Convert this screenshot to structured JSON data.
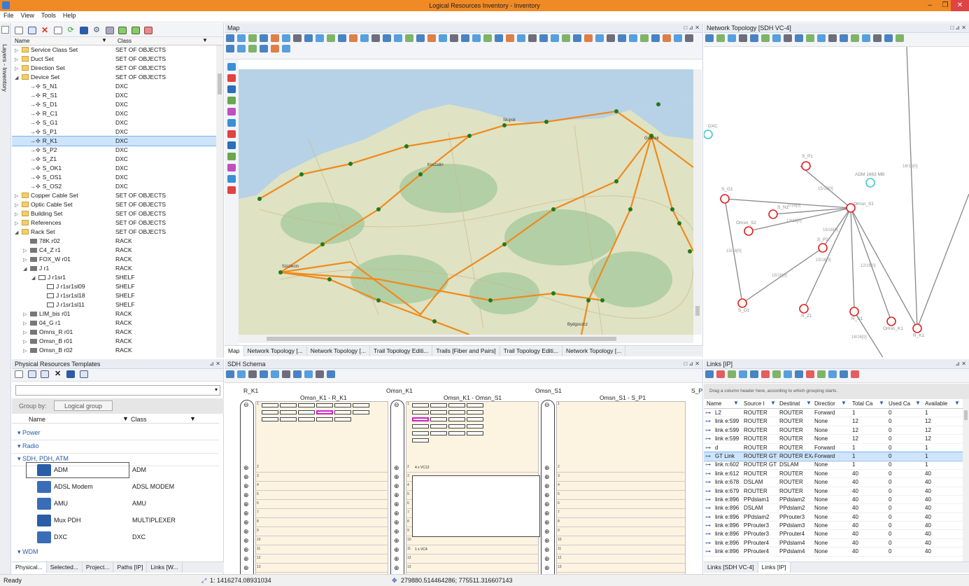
{
  "window": {
    "title": "Logical Resources Inventory - Inventory",
    "controls": [
      "–",
      "❐",
      "✕"
    ]
  },
  "menu": [
    "File",
    "View",
    "Tools",
    "Help"
  ],
  "left_side_tab": "Layers - Inventory",
  "tree": {
    "col_name": "Name",
    "col_class": "Class",
    "rows": [
      {
        "indent": 1,
        "exp": "▷",
        "icon": "folder",
        "name": "Service Class Set",
        "cls": "SET OF OBJECTS"
      },
      {
        "indent": 1,
        "exp": "▷",
        "icon": "folder",
        "name": "Duct Set",
        "cls": "SET OF OBJECTS"
      },
      {
        "indent": 1,
        "exp": "▷",
        "icon": "folder",
        "name": "Direction Set",
        "cls": "SET OF OBJECTS"
      },
      {
        "indent": 1,
        "exp": "◢",
        "icon": "folder",
        "name": "Device Set",
        "cls": "SET OF OBJECTS"
      },
      {
        "indent": 2,
        "exp": "",
        "icon": "dxc",
        "name": "S_N1",
        "cls": "DXC"
      },
      {
        "indent": 2,
        "exp": "",
        "icon": "dxc",
        "name": "R_S1",
        "cls": "DXC"
      },
      {
        "indent": 2,
        "exp": "",
        "icon": "dxc",
        "name": "S_D1",
        "cls": "DXC"
      },
      {
        "indent": 2,
        "exp": "",
        "icon": "dxc",
        "name": "R_C1",
        "cls": "DXC"
      },
      {
        "indent": 2,
        "exp": "",
        "icon": "dxc",
        "name": "S_G1",
        "cls": "DXC"
      },
      {
        "indent": 2,
        "exp": "",
        "icon": "dxc",
        "name": "S_P1",
        "cls": "DXC"
      },
      {
        "indent": 2,
        "exp": "",
        "icon": "dxc",
        "name": "R_K1",
        "cls": "DXC",
        "sel": true
      },
      {
        "indent": 2,
        "exp": "",
        "icon": "dxc",
        "name": "S_P2",
        "cls": "DXC"
      },
      {
        "indent": 2,
        "exp": "",
        "icon": "dxc",
        "name": "S_Z1",
        "cls": "DXC"
      },
      {
        "indent": 2,
        "exp": "",
        "icon": "dxc",
        "name": "S_OK1",
        "cls": "DXC"
      },
      {
        "indent": 2,
        "exp": "",
        "icon": "dxc",
        "name": "S_OS1",
        "cls": "DXC"
      },
      {
        "indent": 2,
        "exp": "",
        "icon": "dxc",
        "name": "S_OS2",
        "cls": "DXC"
      },
      {
        "indent": 1,
        "exp": "▷",
        "icon": "folder",
        "name": "Copper Cable Set",
        "cls": "SET OF OBJECTS"
      },
      {
        "indent": 1,
        "exp": "▷",
        "icon": "folder",
        "name": "Optic Cable Set",
        "cls": "SET OF OBJECTS"
      },
      {
        "indent": 1,
        "exp": "▷",
        "icon": "folder",
        "name": "Building Set",
        "cls": "SET OF OBJECTS"
      },
      {
        "indent": 1,
        "exp": "▷",
        "icon": "folder",
        "name": "References",
        "cls": "SET OF OBJECTS"
      },
      {
        "indent": 1,
        "exp": "◢",
        "icon": "folder",
        "name": "Rack Set",
        "cls": "SET OF OBJECTS"
      },
      {
        "indent": 2,
        "exp": "",
        "icon": "rack",
        "name": "78K r02",
        "cls": "RACK"
      },
      {
        "indent": 2,
        "exp": "▷",
        "icon": "rack",
        "name": "C4_Z r1",
        "cls": "RACK"
      },
      {
        "indent": 2,
        "exp": "▷",
        "icon": "rack",
        "name": "FOX_W r01",
        "cls": "RACK"
      },
      {
        "indent": 2,
        "exp": "◢",
        "icon": "rack",
        "name": "J r1",
        "cls": "RACK"
      },
      {
        "indent": 3,
        "exp": "◢",
        "icon": "shelf",
        "name": "J r1sr1",
        "cls": "SHELF"
      },
      {
        "indent": 4,
        "exp": "",
        "icon": "shelf",
        "name": "J r1sr1sl09",
        "cls": "SHELF"
      },
      {
        "indent": 4,
        "exp": "",
        "icon": "shelf",
        "name": "J r1sr1sl18",
        "cls": "SHELF"
      },
      {
        "indent": 4,
        "exp": "",
        "icon": "shelf",
        "name": "J r1sr1sl11",
        "cls": "SHELF"
      },
      {
        "indent": 2,
        "exp": "▷",
        "icon": "rack",
        "name": "LIM_bis r01",
        "cls": "RACK"
      },
      {
        "indent": 2,
        "exp": "▷",
        "icon": "rack",
        "name": "04_G r1",
        "cls": "RACK"
      },
      {
        "indent": 2,
        "exp": "▷",
        "icon": "rack",
        "name": "Omns_R r01",
        "cls": "RACK"
      },
      {
        "indent": 2,
        "exp": "▷",
        "icon": "rack",
        "name": "Omsn_B r01",
        "cls": "RACK"
      },
      {
        "indent": 2,
        "exp": "▷",
        "icon": "rack",
        "name": "Omsn_B r02",
        "cls": "RACK"
      }
    ]
  },
  "templates": {
    "title": "Physical Resources Templates",
    "group_by_label": "Group by:",
    "group_btn": "Logical group",
    "col_name": "Name",
    "col_class": "Class",
    "groups": [
      "Power",
      "Radio",
      "SDH, PDH, ATM"
    ],
    "items": [
      {
        "name": "ADM",
        "cls": "ADM",
        "sel": true
      },
      {
        "name": "ADSL Modem",
        "cls": "ADSL MODEM"
      },
      {
        "name": "AMU",
        "cls": "AMU"
      },
      {
        "name": "Mux PDH",
        "cls": "MULTIPLEXER"
      },
      {
        "name": "DXC",
        "cls": "DXC"
      }
    ],
    "last_group": "WDM",
    "tabs": [
      "Physical...",
      "Selected...",
      "Project...",
      "Paths [IP]",
      "Links [W..."
    ]
  },
  "map": {
    "title": "Map",
    "cities": [
      "Gdańsk",
      "Koszalin",
      "Szczecin",
      "Bydgoszcz",
      "Słupsk"
    ],
    "tabs": [
      "Map",
      "Network Topology [...",
      "Network Topology [...",
      "Trail Topology Editi...",
      "Trails [Fiber and Pairs]",
      "Trail Topology Editi...",
      "Network Topology [..."
    ]
  },
  "topology": {
    "title": "Network Topology [SDH VC-4]",
    "nodes": [
      {
        "label": "DXC",
        "kind": "cyan"
      },
      {
        "label": "S_P1",
        "kind": "red"
      },
      {
        "label": "ADM 1663 MB",
        "kind": "cyan"
      },
      {
        "label": "S_G1",
        "kind": "red"
      },
      {
        "label": "S_N1",
        "kind": "red"
      },
      {
        "label": "Omsn_S1",
        "kind": "red"
      },
      {
        "label": "Omsn_S2",
        "kind": "red"
      },
      {
        "label": "S_P2",
        "kind": "red"
      },
      {
        "label": "S_D1",
        "kind": "red"
      },
      {
        "label": "S_Z1",
        "kind": "red"
      },
      {
        "label": "R_S1",
        "kind": "red"
      },
      {
        "label": "Omsn_K1",
        "kind": "red"
      },
      {
        "label": "R_K1",
        "kind": "red"
      },
      {
        "label": "S_C1",
        "kind": "red"
      }
    ],
    "edge_labels": [
      "16/16[0]",
      "15/16[0]",
      "13/16[0]",
      "15/16[0]",
      "15/16[0]",
      "15/16[0]",
      "12/16[0]",
      "15/16[0]",
      "16/16[0]",
      "1/16[0]"
    ]
  },
  "sdh": {
    "title": "SDH Schema",
    "nodes": [
      "R_K1",
      "Omsn_K1",
      "Omsn_S1",
      "S_P"
    ],
    "links": [
      "Omsn_K1 - R_K1",
      "Omsn_K1 - Omsn_S1",
      "Omsn_S1 - S_P1"
    ],
    "note1": "4 x VC12",
    "note2": "1 x VC4",
    "row_nums": [
      "1",
      "2",
      "3",
      "4",
      "5",
      "6",
      "7",
      "8",
      "9",
      "10",
      "11",
      "12",
      "13"
    ]
  },
  "links": {
    "title": "Links [IP]",
    "hint": "Drag a column header here, according to which grouping starts.",
    "columns": [
      "Name",
      "Source I",
      "Destinat",
      "Directior",
      "Total Ca",
      "Used Ca",
      "Available"
    ],
    "rows": [
      [
        "L2",
        "ROUTER",
        "ROUTER",
        "Forward",
        "1",
        "0",
        "1"
      ],
      [
        "link e:599",
        "ROUTER",
        "ROUTER",
        "None",
        "12",
        "0",
        "12"
      ],
      [
        "link e:599",
        "ROUTER",
        "ROUTER",
        "None",
        "12",
        "0",
        "12"
      ],
      [
        "link e:599",
        "ROUTER",
        "ROUTER",
        "None",
        "12",
        "0",
        "12"
      ],
      [
        "d",
        "ROUTER",
        "ROUTER",
        "Forward",
        "1",
        "0",
        "1"
      ],
      [
        "GT Link",
        "ROUTER GTS",
        "ROUTER EXA",
        "Forward",
        "1",
        "0",
        "1"
      ],
      [
        "link n:602",
        "ROUTER GTS",
        "DSLAM",
        "None",
        "1",
        "0",
        "1"
      ],
      [
        "link e:612",
        "ROUTER",
        "ROUTER",
        "None",
        "40",
        "0",
        "40"
      ],
      [
        "link e:678",
        "DSLAM",
        "ROUTER",
        "None",
        "40",
        "0",
        "40"
      ],
      [
        "link e:679",
        "ROUTER",
        "ROUTER",
        "None",
        "40",
        "0",
        "40"
      ],
      [
        "link e:896",
        "PPdslam1",
        "PPdslam2",
        "None",
        "40",
        "0",
        "40"
      ],
      [
        "link e:896",
        "DSLAM",
        "PPdslam2",
        "None",
        "40",
        "0",
        "40"
      ],
      [
        "link e:896",
        "PPdslam2",
        "PProuter3",
        "None",
        "40",
        "0",
        "40"
      ],
      [
        "link e:896",
        "PProuter3",
        "PPdslam3",
        "None",
        "40",
        "0",
        "40"
      ],
      [
        "link e:896",
        "PProuter3",
        "PProuter4",
        "None",
        "40",
        "0",
        "40"
      ],
      [
        "link e:896",
        "PProuter4",
        "PPdslam4",
        "None",
        "40",
        "0",
        "40"
      ],
      [
        "link e:896",
        "PProuter4",
        "PPdslam4",
        "None",
        "40",
        "0",
        "40"
      ]
    ],
    "tabs": [
      "Links [SDH VC-4]",
      "Links [IP]"
    ]
  },
  "status": {
    "ready": "Ready",
    "coord1": "1: 1416274.08931034",
    "coord2": "279880.514464286; 775511.316607143"
  }
}
